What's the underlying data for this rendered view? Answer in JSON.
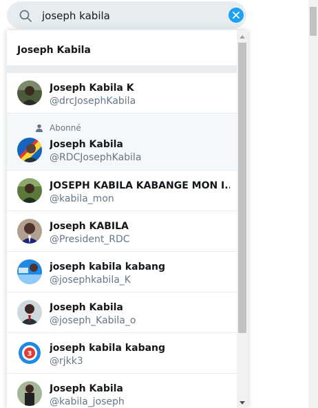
{
  "search": {
    "query": "joseph kabila"
  },
  "dropdown": {
    "query_suggestion": "Joseph Kabila",
    "results": [
      {
        "name": "Joseph Kabila K",
        "handle": "@drcJosephKabila",
        "following": false,
        "avatar": "photo-dark"
      },
      {
        "name": "Joseph Kabila",
        "handle": "@RDCJosephKabila",
        "following": true,
        "following_label": "Abonné",
        "avatar": "photo-blue"
      },
      {
        "name": "JOSEPH KABILA KABANGE MON I...",
        "handle": "@kabila_mon",
        "following": false,
        "avatar": "photo-green"
      },
      {
        "name": "Joseph KABILA",
        "handle": "@President_RDC",
        "following": false,
        "avatar": "photo-portrait"
      },
      {
        "name": "joseph kabila kabang",
        "handle": "@josephkabila_K",
        "following": false,
        "avatar": "photo-banner"
      },
      {
        "name": "Joseph Kabila",
        "handle": "@joseph_Kabila_o",
        "following": false,
        "avatar": "photo-suit"
      },
      {
        "name": "joseph kabila kabang",
        "handle": "@rjkk3",
        "following": false,
        "avatar": "logo-badge"
      },
      {
        "name": "Joseph Kabila",
        "handle": "@kabila_joseph",
        "following": false,
        "avatar": "photo-standing"
      }
    ]
  },
  "colors": {
    "accent": "#1da1f2",
    "search_bg": "#e6ecf0",
    "secondary_text": "#657786"
  }
}
